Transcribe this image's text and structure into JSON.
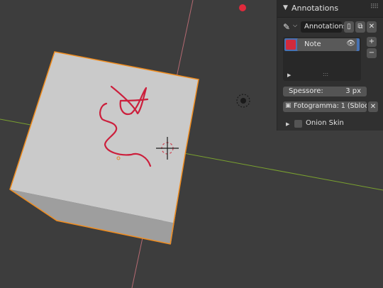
{
  "panel": {
    "title": "Annotations",
    "datablock_name": "Annotations",
    "layers": [
      {
        "name": "Note",
        "color": "#d12a3c",
        "visible": true
      }
    ],
    "thickness": {
      "label": "Spessore:",
      "value": "3 px"
    },
    "frame_label": "Fotogramma: 1 (Sbloc...",
    "onion_skin_label": "Onion Skin",
    "onion_skin_checked": false
  },
  "viewport": {
    "background": "#3d3d3d",
    "cube_face_color": "#c9c9c9",
    "cube_side_color": "#a5a5a5",
    "selection_outline_color": "#f08c1e",
    "annotation_color": "#cc1f3c"
  }
}
